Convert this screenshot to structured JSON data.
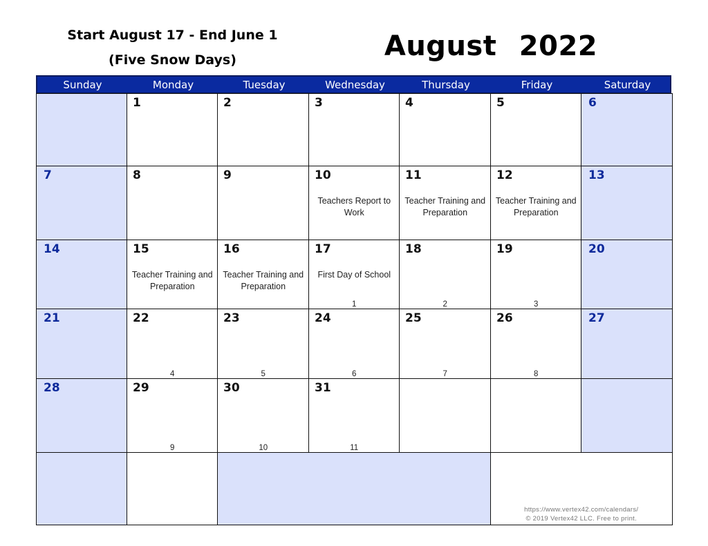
{
  "header": {
    "subtitle_line1": "Start August 17 - End June 1",
    "subtitle_line2": "(Five Snow Days)",
    "month_title": "August 2022"
  },
  "colors": {
    "header_bg": "#0a2aa0",
    "weekend_bg": "#dae1fb",
    "weekend_text": "#0e2a9b"
  },
  "weekdays": [
    "Sunday",
    "Monday",
    "Tuesday",
    "Wednesday",
    "Thursday",
    "Friday",
    "Saturday"
  ],
  "weeks": [
    [
      {
        "day": "",
        "weekend": true
      },
      {
        "day": "1"
      },
      {
        "day": "2"
      },
      {
        "day": "3"
      },
      {
        "day": "4"
      },
      {
        "day": "5"
      },
      {
        "day": "6",
        "weekend": true
      }
    ],
    [
      {
        "day": "7",
        "weekend": true
      },
      {
        "day": "8"
      },
      {
        "day": "9"
      },
      {
        "day": "10",
        "event": "Teachers Report to Work"
      },
      {
        "day": "11",
        "event": "Teacher Training and Preparation"
      },
      {
        "day": "12",
        "event": "Teacher Training and Preparation"
      },
      {
        "day": "13",
        "weekend": true
      }
    ],
    [
      {
        "day": "14",
        "weekend": true
      },
      {
        "day": "15",
        "event": "Teacher Training and Preparation"
      },
      {
        "day": "16",
        "event": "Teacher Training and Preparation"
      },
      {
        "day": "17",
        "event": "First Day of School",
        "count": "1"
      },
      {
        "day": "18",
        "count": "2"
      },
      {
        "day": "19",
        "count": "3"
      },
      {
        "day": "20",
        "weekend": true
      }
    ],
    [
      {
        "day": "21",
        "weekend": true
      },
      {
        "day": "22",
        "count": "4"
      },
      {
        "day": "23",
        "count": "5"
      },
      {
        "day": "24",
        "count": "6"
      },
      {
        "day": "25",
        "count": "7"
      },
      {
        "day": "26",
        "count": "8"
      },
      {
        "day": "27",
        "weekend": true
      }
    ],
    [
      {
        "day": "28",
        "weekend": true
      },
      {
        "day": "29",
        "count": "9"
      },
      {
        "day": "30",
        "count": "10"
      },
      {
        "day": "31",
        "count": "11"
      },
      {
        "day": ""
      },
      {
        "day": ""
      },
      {
        "day": "",
        "weekend": true
      }
    ]
  ],
  "footer": {
    "url": "https://www.vertex42.com/calendars/",
    "copyright": "© 2019 Vertex42 LLC. Free to print."
  }
}
